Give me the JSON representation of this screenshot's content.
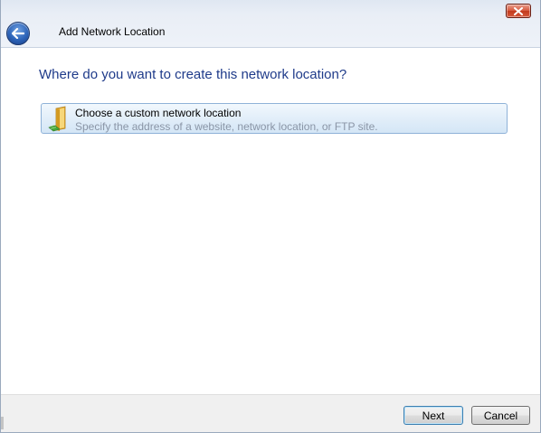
{
  "window": {
    "title": "Add Network Location",
    "close_icon": "close-icon",
    "back_icon": "back-arrow-icon"
  },
  "main": {
    "heading": "Where do you want to create this network location?",
    "options": [
      {
        "title": "Choose a custom network location",
        "description": "Specify the address of a website, network location, or FTP site.",
        "icon": "network-folder-icon",
        "selected": true
      }
    ]
  },
  "footer": {
    "next_label": "Next",
    "cancel_label": "Cancel"
  },
  "colors": {
    "heading": "#1f3b8a",
    "option_highlight": "#d4e6f6",
    "close_button": "#c23a1d"
  }
}
